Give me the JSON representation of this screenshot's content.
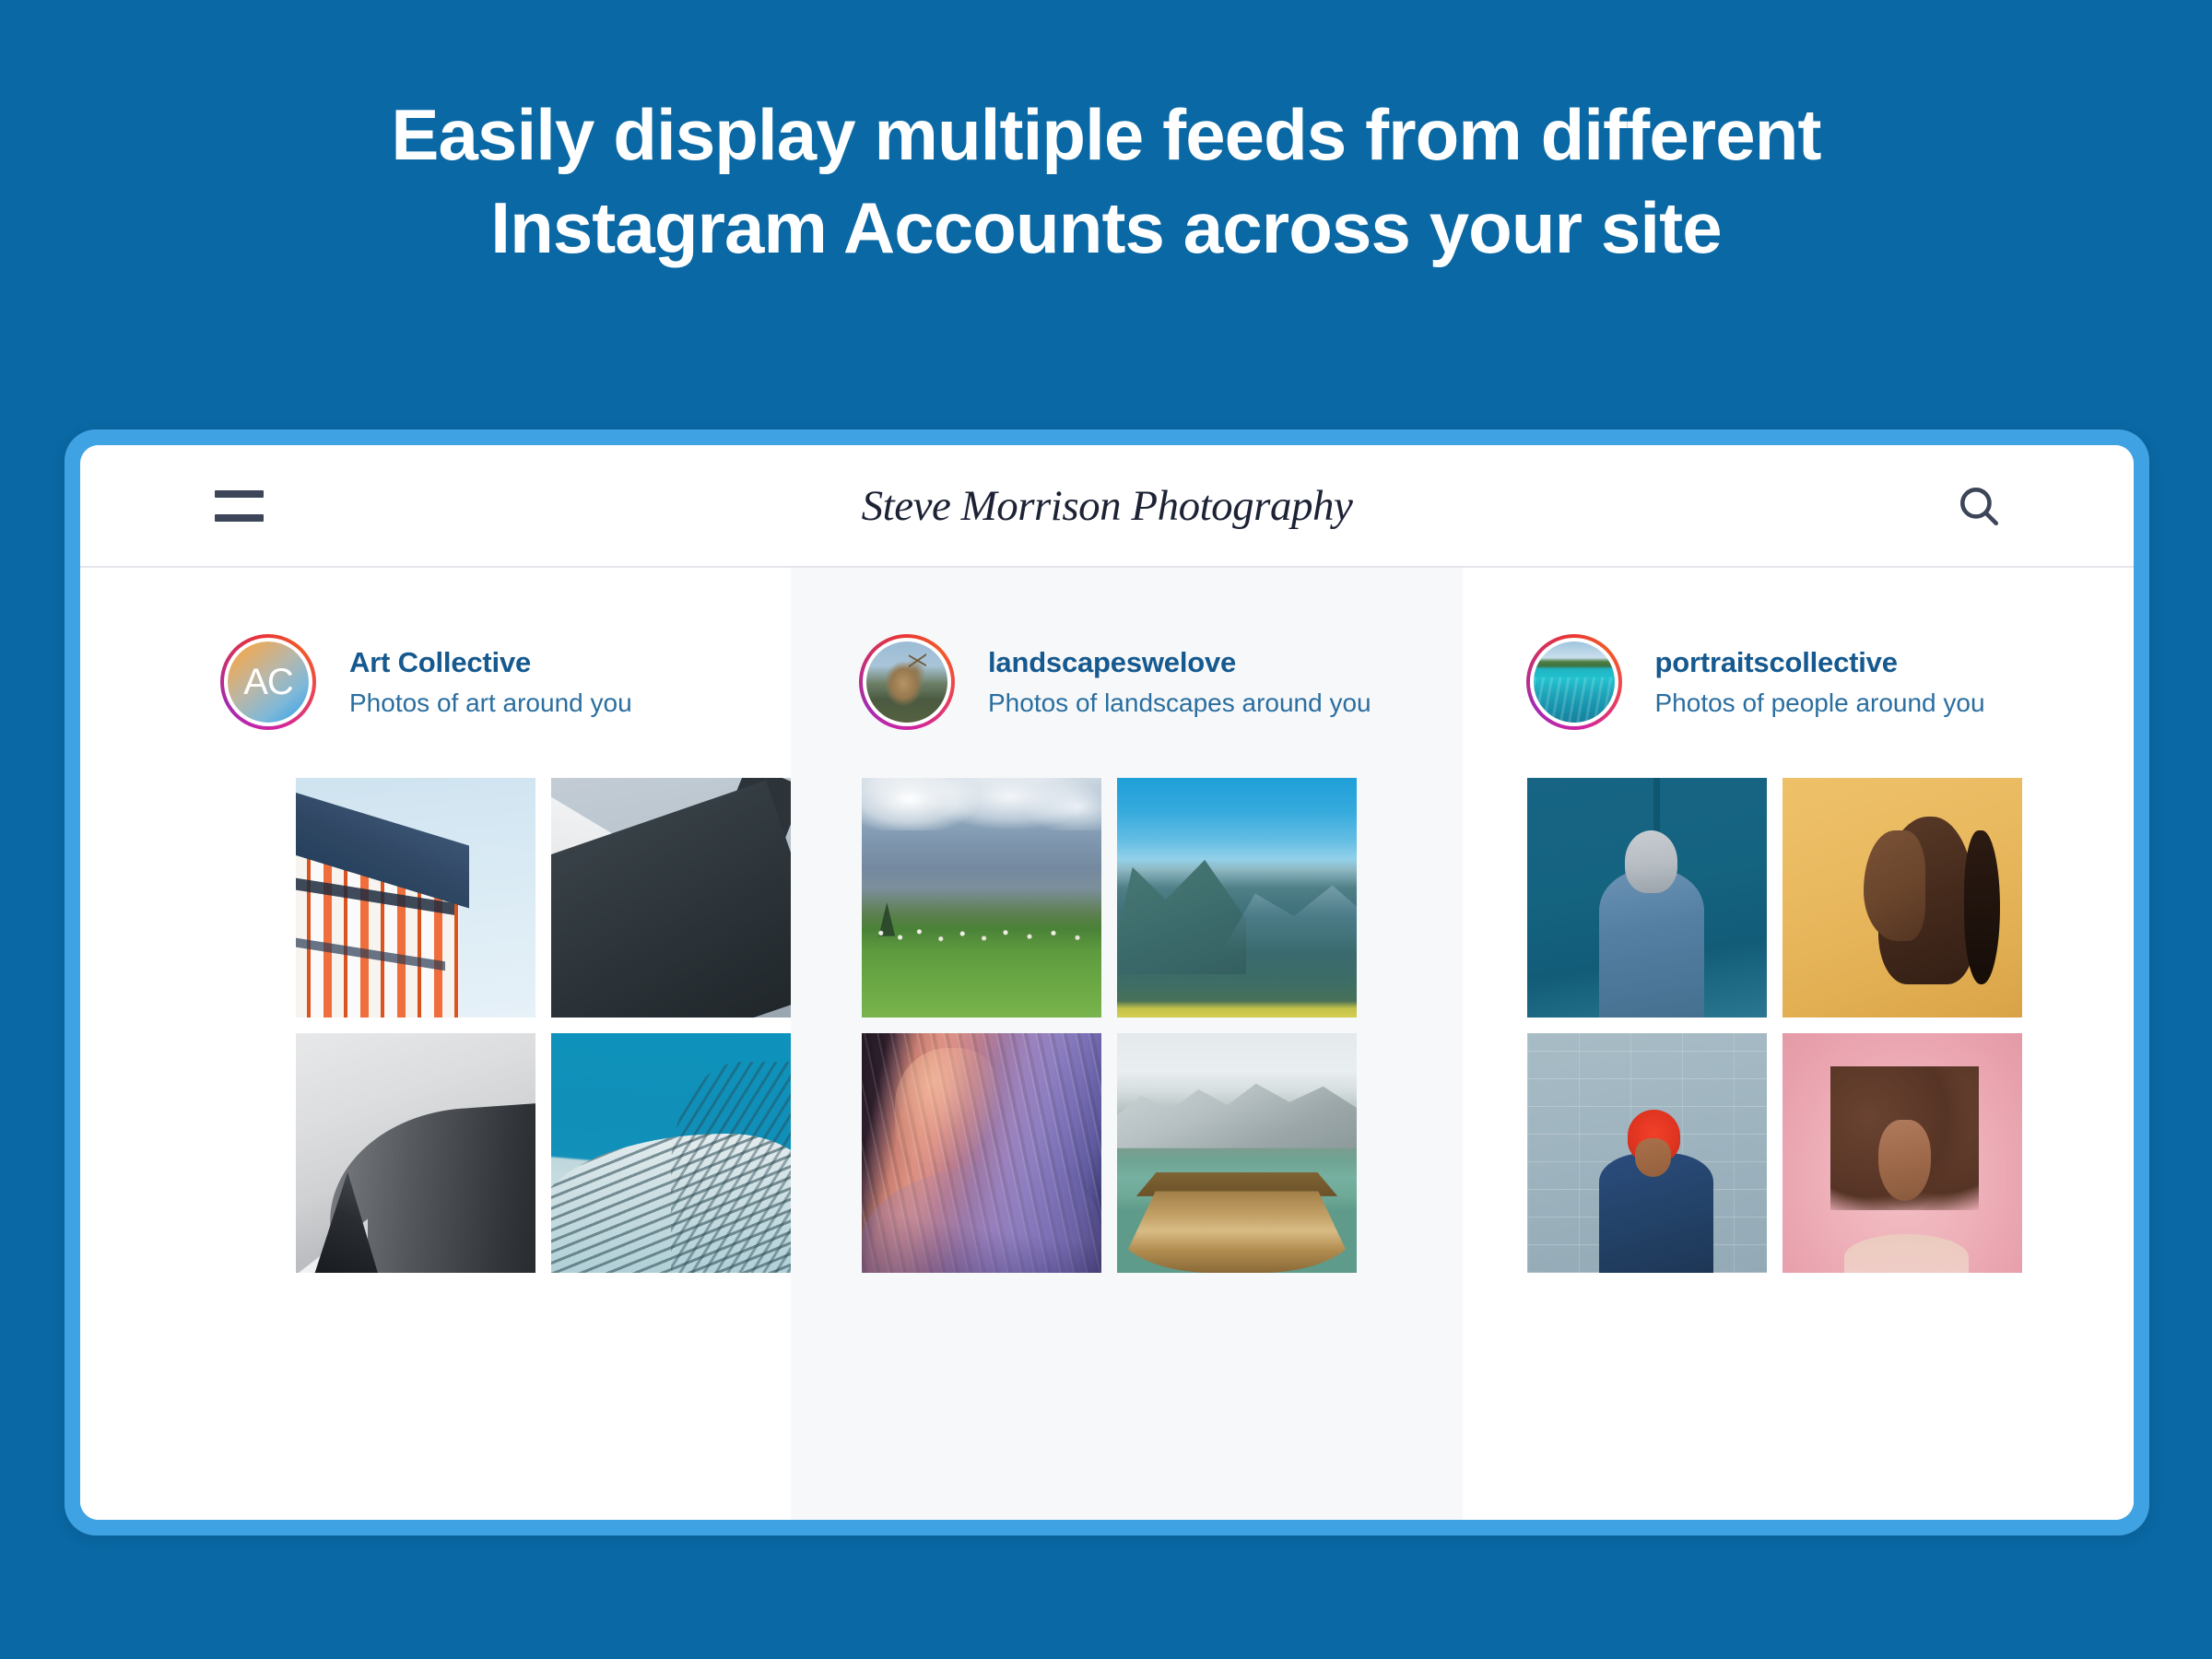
{
  "hero": {
    "line1": "Easily display multiple feeds from different",
    "line2": "Instagram Accounts across your site"
  },
  "colors": {
    "page_background": "#0a68a4",
    "frame_border": "#3fa2e2",
    "window_background": "#ffffff",
    "shaded_column_background": "#f7f8fa",
    "feed_title": "#15598f",
    "feed_subtitle": "#2a6e9f",
    "header_icon": "#3d4559",
    "logo_text": "#1d2335",
    "header_divider": "#e4e6ea"
  },
  "browser": {
    "site_header": {
      "menu_icon": "hamburger-icon",
      "logo_text": "Steve Morrison Photography",
      "search_icon": "search-icon"
    },
    "feeds": [
      {
        "id": "art-collective",
        "shaded": false,
        "avatar_type": "monogram",
        "avatar_initials": "AC",
        "title": "Art Collective",
        "subtitle": "Photos of art around you",
        "photos": [
          {
            "alt": "Parisian apartment building facade with orange stripes"
          },
          {
            "alt": "Modern architecture white and dark angular roof lines"
          },
          {
            "alt": "Black and white curved metallic concert hall facade"
          },
          {
            "alt": "Teal sky over patterned woven building exterior"
          }
        ]
      },
      {
        "id": "landscapeswelove",
        "shaded": true,
        "avatar_type": "photo-elk",
        "avatar_initials": "",
        "title": "landscapeswelove",
        "subtitle": "Photos of landscapes around you",
        "photos": [
          {
            "alt": "Green alpine meadow with grazing sheep below mountains"
          },
          {
            "alt": "Hazy blue layered mountain valley with yellow blooms"
          },
          {
            "alt": "Pink and purple slot canyon sandstone waves"
          },
          {
            "alt": "Wooden rowboat bow on emerald alpine lake"
          }
        ]
      },
      {
        "id": "portraitscollective",
        "shaded": false,
        "avatar_type": "photo-lagoon",
        "avatar_initials": "",
        "title": "portraitscollective",
        "subtitle": "Photos of people around you",
        "photos": [
          {
            "alt": "Smiling woman in denim jacket against blue wall"
          },
          {
            "alt": "Profile portrait of woman with long ponytail on gold backdrop"
          },
          {
            "alt": "Woman with red hair pointing against blue brick wall"
          },
          {
            "alt": "Portrait of woman with afro on pink background"
          }
        ]
      }
    ]
  }
}
